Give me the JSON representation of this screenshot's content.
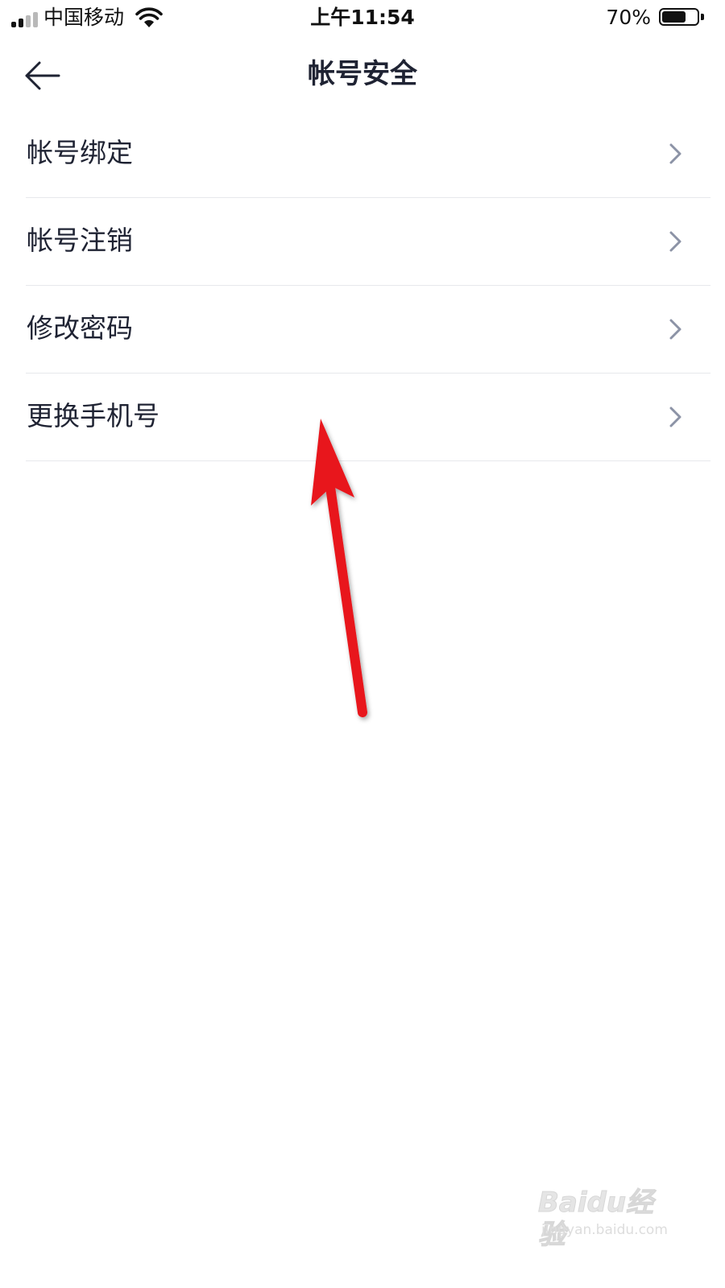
{
  "status_bar": {
    "carrier": "中国移动",
    "time": "上午11:54",
    "battery_percent": "70%",
    "battery_level": 0.7,
    "signal_bars_active": 2,
    "signal_bars_total": 4,
    "icons": [
      "signal-icon",
      "wifi-icon",
      "battery-icon"
    ]
  },
  "nav": {
    "title": "帐号安全",
    "back_icon": "back-arrow-icon"
  },
  "menu": {
    "items": [
      {
        "label": "帐号绑定",
        "icon": "chevron-right-icon"
      },
      {
        "label": "帐号注销",
        "icon": "chevron-right-icon"
      },
      {
        "label": "修改密码",
        "icon": "chevron-right-icon"
      },
      {
        "label": "更换手机号",
        "icon": "chevron-right-icon"
      }
    ]
  },
  "annotation": {
    "icon": "red-arrow-annotation-icon",
    "color": "#e8141b"
  },
  "watermark": {
    "brand": "Baidu经验",
    "url": "jingyan.baidu.com"
  },
  "colors": {
    "text_primary": "#1f2333",
    "chevron": "#8c93a6",
    "divider": "#e7e8ec",
    "background": "#ffffff"
  }
}
